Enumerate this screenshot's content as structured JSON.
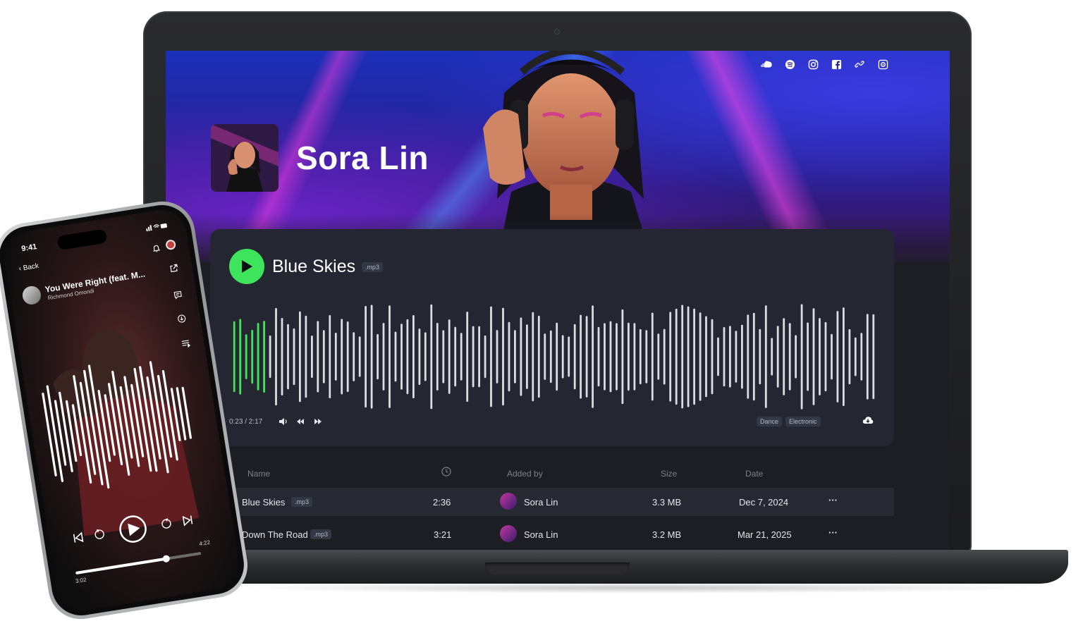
{
  "artist": {
    "name": "Sora Lin"
  },
  "social_icons": [
    "soundcloud-icon",
    "spotify-icon",
    "instagram-icon",
    "facebook-icon",
    "link-icon",
    "settings-icon"
  ],
  "player": {
    "track_title": "Blue Skies",
    "format": ".mp3",
    "time": "0:23 / 2:17",
    "progress": 0.17,
    "tags": [
      "Dance",
      "Electronic"
    ],
    "accent_color": "#3ee45c"
  },
  "table": {
    "headers": {
      "name": "Name",
      "added_by": "Added by",
      "size": "Size",
      "date": "Date"
    },
    "rows": [
      {
        "name": "Blue Skies",
        "format": ".mp3",
        "duration": "2:36",
        "added_by": "Sora Lin",
        "size": "3.3 MB",
        "date": "Dec 7, 2024",
        "more": "···",
        "playing": true
      },
      {
        "name": "Down The Road",
        "format": ".mp3",
        "duration": "3:21",
        "added_by": "Sora Lin",
        "size": "3.2 MB",
        "date": "Mar 21, 2025",
        "more": "···",
        "playing": false
      }
    ]
  },
  "phone": {
    "time": "9:41",
    "back_label": "Back",
    "track_title": "You Were Right (feat. M...",
    "track_artist": "Richmond Omondi",
    "elapsed": "3:02",
    "total": "4:22",
    "progress": 0.72
  }
}
